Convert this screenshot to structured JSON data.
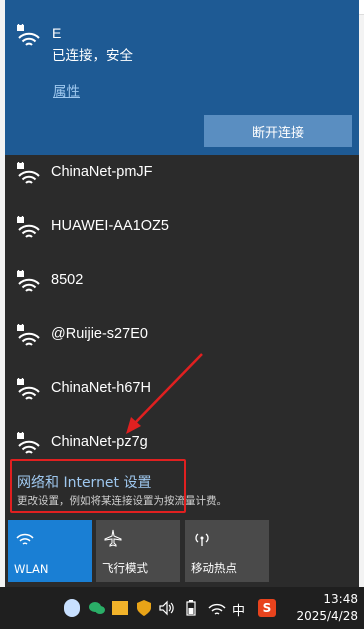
{
  "connected": {
    "name": "E",
    "status": "已连接，安全",
    "properties_link": "属性",
    "disconnect_button": "断开连接"
  },
  "networks": [
    {
      "ssid": "ChinaNet-pmJF",
      "secured": true
    },
    {
      "ssid": "HUAWEI-AA1OZ5",
      "secured": true
    },
    {
      "ssid": "8502",
      "secured": true
    },
    {
      "ssid": "@Ruijie-s27E0",
      "secured": true
    },
    {
      "ssid": "ChinaNet-h67H",
      "secured": true
    },
    {
      "ssid": "ChinaNet-pz7g",
      "secured": true
    }
  ],
  "settings": {
    "title": "网络和 Internet 设置",
    "subtitle": "更改设置，例如将某连接设置为按流量计费。"
  },
  "quick_actions": [
    {
      "label": "WLAN",
      "icon": "wifi-icon",
      "active": true
    },
    {
      "label": "飞行模式",
      "icon": "airplane-icon",
      "active": false
    },
    {
      "label": "移动热点",
      "icon": "hotspot-icon",
      "active": false
    }
  ],
  "taskbar": {
    "ime_label": "中",
    "time": "13:48",
    "date": "2025/4/28"
  },
  "colors": {
    "accent": "#1e5a94",
    "active_tile": "#1a7fd4",
    "link": "#9fc8ef",
    "annotation": "#e02020"
  }
}
